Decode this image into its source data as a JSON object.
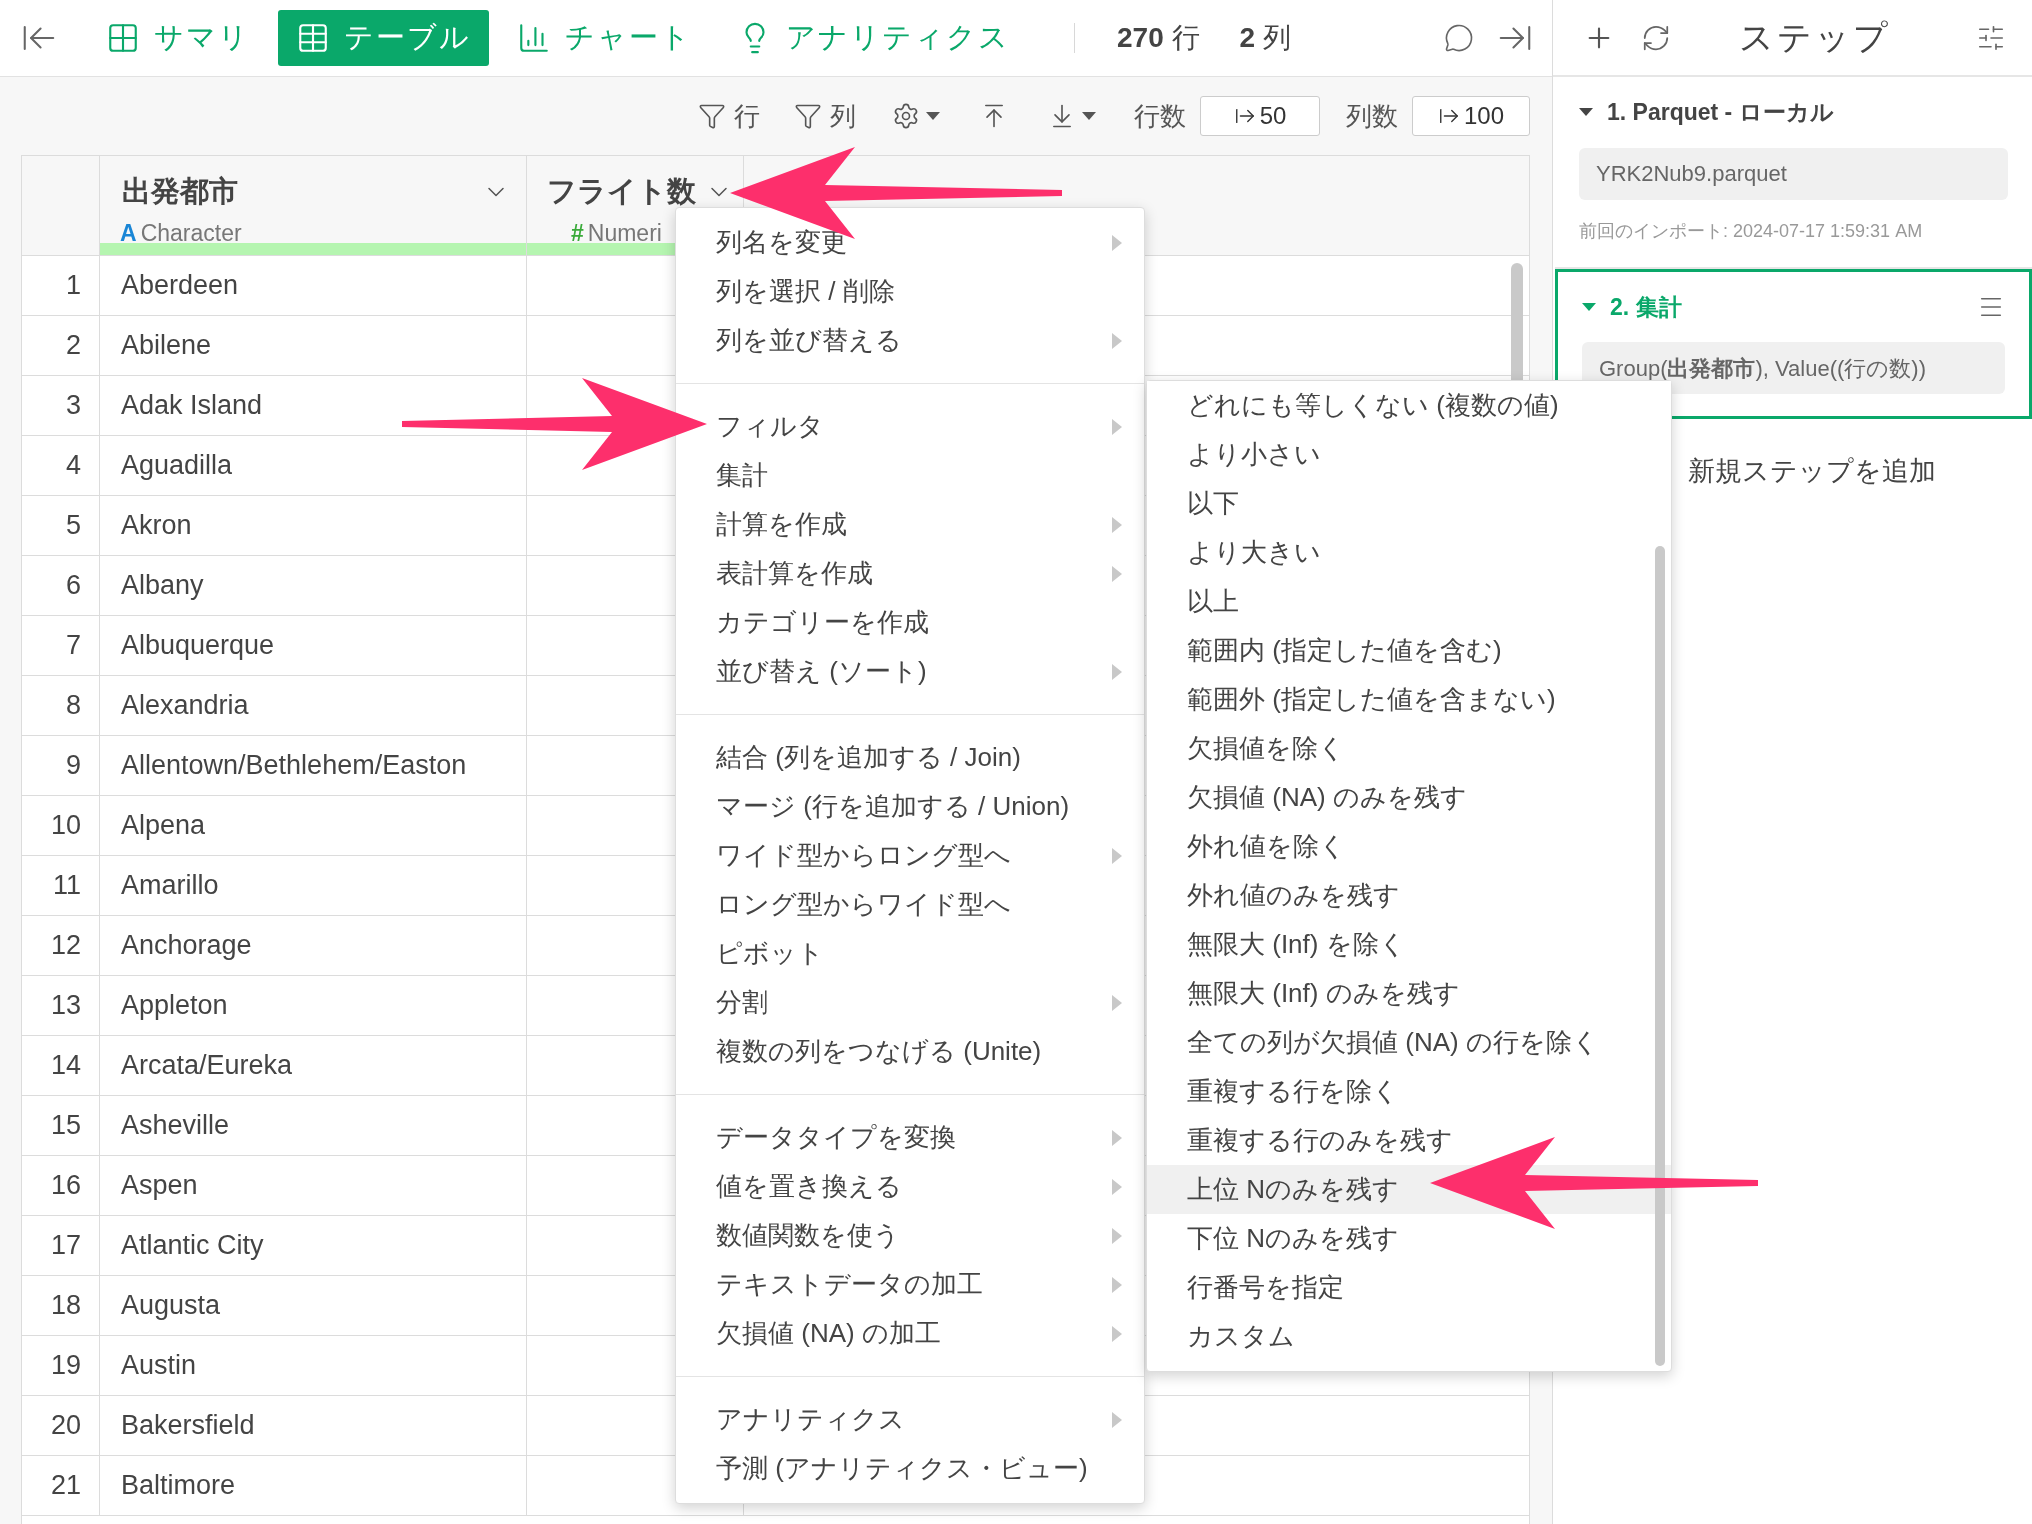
{
  "top_bar": {
    "tabs": [
      {
        "label": "サマリ",
        "kind": "grid",
        "selected": false
      },
      {
        "label": "テーブル",
        "kind": "table",
        "selected": true
      },
      {
        "label": "チャート",
        "kind": "chart",
        "selected": false
      },
      {
        "label": "アナリティクス",
        "kind": "bulb",
        "selected": false
      }
    ],
    "row_count": {
      "value": "270",
      "unit": "行"
    },
    "column_count": {
      "value": "2",
      "unit": "列"
    }
  },
  "table_toolbar": {
    "row_filter": "行",
    "column_filter": "列",
    "rows_label": "行数",
    "rows_value": "50",
    "columns_label": "列数",
    "columns_value": "100"
  },
  "table": {
    "columns": [
      {
        "name": "出発都市",
        "kind": "character",
        "type_mark": "A",
        "type": "Character"
      },
      {
        "name": "フライト数",
        "kind": "numeric",
        "type_mark": "#",
        "type": "Numeri"
      }
    ],
    "rows": [
      {
        "number": "1",
        "city": "Aberdeen"
      },
      {
        "number": "2",
        "city": "Abilene"
      },
      {
        "number": "3",
        "city": "Adak Island"
      },
      {
        "number": "4",
        "city": "Aguadilla"
      },
      {
        "number": "5",
        "city": "Akron"
      },
      {
        "number": "6",
        "city": "Albany"
      },
      {
        "number": "7",
        "city": "Albuquerque"
      },
      {
        "number": "8",
        "city": "Alexandria"
      },
      {
        "number": "9",
        "city": "Allentown/Bethlehem/Easton"
      },
      {
        "number": "10",
        "city": "Alpena"
      },
      {
        "number": "11",
        "city": "Amarillo"
      },
      {
        "number": "12",
        "city": "Anchorage"
      },
      {
        "number": "13",
        "city": "Appleton"
      },
      {
        "number": "14",
        "city": "Arcata/Eureka"
      },
      {
        "number": "15",
        "city": "Asheville"
      },
      {
        "number": "16",
        "city": "Aspen"
      },
      {
        "number": "17",
        "city": "Atlantic City"
      },
      {
        "number": "18",
        "city": "Augusta"
      },
      {
        "number": "19",
        "city": "Austin"
      },
      {
        "number": "20",
        "city": "Bakersfield"
      },
      {
        "number": "21",
        "city": "Baltimore"
      }
    ]
  },
  "column_menu": {
    "groups": [
      [
        {
          "label": "列名を変更",
          "submenu": true
        },
        {
          "label": "列を選択 / 削除",
          "submenu": false
        },
        {
          "label": "列を並び替える",
          "submenu": true
        }
      ],
      [
        {
          "label": "フィルタ",
          "submenu": true
        },
        {
          "label": "集計",
          "submenu": false
        },
        {
          "label": "計算を作成",
          "submenu": true
        },
        {
          "label": "表計算を作成",
          "submenu": true
        },
        {
          "label": "カテゴリーを作成",
          "submenu": false
        },
        {
          "label": "並び替え (ソート)",
          "submenu": true
        }
      ],
      [
        {
          "label": "結合 (列を追加する / Join)",
          "submenu": false
        },
        {
          "label": "マージ (行を追加する / Union)",
          "submenu": false
        },
        {
          "label": "ワイド型からロング型へ",
          "submenu": true
        },
        {
          "label": "ロング型からワイド型へ",
          "submenu": false
        },
        {
          "label": "ピボット",
          "submenu": false
        },
        {
          "label": "分割",
          "submenu": true
        },
        {
          "label": "複数の列をつなげる (Unite)",
          "submenu": false
        }
      ],
      [
        {
          "label": "データタイプを変換",
          "submenu": true
        },
        {
          "label": "値を置き換える",
          "submenu": true
        },
        {
          "label": "数値関数を使う",
          "submenu": true
        },
        {
          "label": "テキストデータの加工",
          "submenu": true
        },
        {
          "label": "欠損値 (NA) の加工",
          "submenu": true
        }
      ],
      [
        {
          "label": "アナリティクス",
          "submenu": true
        },
        {
          "label": "予測 (アナリティクス・ビュー)",
          "submenu": false
        }
      ]
    ]
  },
  "filter_submenu": {
    "items": [
      {
        "label": "どれにも等しくない (複数の値)",
        "selected": false
      },
      {
        "label": "より小さい",
        "selected": false
      },
      {
        "label": "以下",
        "selected": false
      },
      {
        "label": "より大きい",
        "selected": false
      },
      {
        "label": "以上",
        "selected": false
      },
      {
        "label": "範囲内 (指定した値を含む)",
        "selected": false
      },
      {
        "label": "範囲外 (指定した値を含まない)",
        "selected": false
      },
      {
        "label": "欠損値を除く",
        "selected": false
      },
      {
        "label": "欠損値 (NA) のみを残す",
        "selected": false
      },
      {
        "label": "外れ値を除く",
        "selected": false
      },
      {
        "label": "外れ値のみを残す",
        "selected": false
      },
      {
        "label": "無限大 (Inf) を除く",
        "selected": false
      },
      {
        "label": "無限大 (Inf) のみを残す",
        "selected": false
      },
      {
        "label": "全ての列が欠損値 (NA) の行を除く",
        "selected": false
      },
      {
        "label": "重複する行を除く",
        "selected": false
      },
      {
        "label": "重複する行のみを残す",
        "selected": false
      },
      {
        "label": "上位 Nのみを残す",
        "selected": true
      },
      {
        "label": "下位 Nのみを残す",
        "selected": false
      },
      {
        "label": "行番号を指定",
        "selected": false
      },
      {
        "label": "カスタム",
        "selected": false
      }
    ]
  },
  "steps_panel": {
    "title": "ステップ",
    "steps": [
      {
        "title": "1. Parquet - ローカル",
        "detail": "YRK2Nub9.parquet",
        "note": "前回のインポート: 2024-07-17 1:59:31 AM",
        "selected": false,
        "expanded": true
      },
      {
        "title": "2. 集計",
        "detail": "Group(**出発都市**), Value((行の数))",
        "selected": true,
        "expanded": true
      }
    ],
    "add_step": "新規ステップを追加"
  }
}
